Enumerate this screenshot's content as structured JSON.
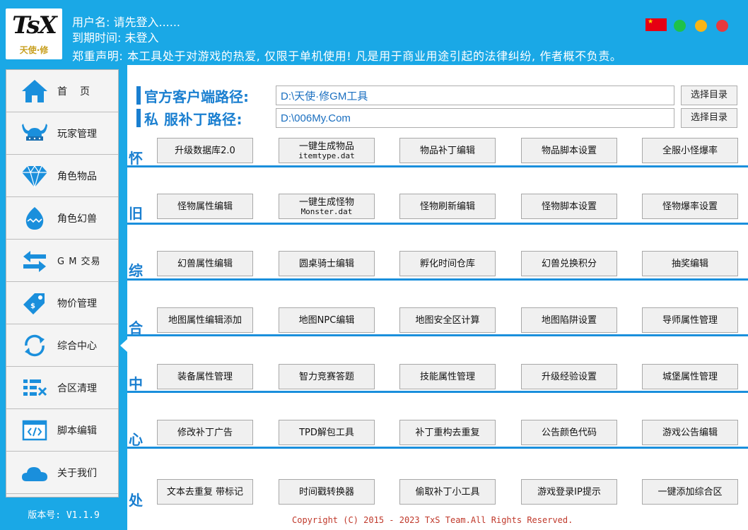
{
  "header": {
    "logo_text": "TsX",
    "logo_subtext": "天使·修",
    "username_line": "用户名: 请先登入......",
    "expiry_line": "到期时间: 未登入",
    "disclaimer_line": "郑重声明: 本工具处于对游戏的热爱, 仅限于单机使用! 凡是用于商业用途引起的法律纠纷, 作者概不负责。",
    "flag_icon": "china-flag-icon",
    "window_dots": [
      {
        "name": "green-dot",
        "color": "#1ec24a"
      },
      {
        "name": "yellow-dot",
        "color": "#f7b516"
      },
      {
        "name": "red-dot",
        "color": "#e8383d"
      }
    ]
  },
  "sidebar": {
    "items": [
      {
        "label": "首页",
        "icon": "home-icon"
      },
      {
        "label": "玩家管理",
        "icon": "viking-helmet-icon"
      },
      {
        "label": "角色物品",
        "icon": "diamond-icon"
      },
      {
        "label": "角色幻兽",
        "icon": "egg-icon"
      },
      {
        "label": "G M 交易",
        "icon": "exchange-arrows-icon"
      },
      {
        "label": "物价管理",
        "icon": "price-tag-icon"
      },
      {
        "label": "综合中心",
        "icon": "refresh-icon"
      },
      {
        "label": "合区清理",
        "icon": "list-clean-icon"
      },
      {
        "label": "脚本编辑",
        "icon": "code-window-icon"
      },
      {
        "label": "关于我们",
        "icon": "cloud-icon"
      }
    ],
    "active_item": "综合中心",
    "version": "版本号: V1.1.9"
  },
  "paths": {
    "official": {
      "label": "官方客户端路径:",
      "value": "D:\\天使·修GM工具",
      "button": "选择目录"
    },
    "private": {
      "label": "私 服补丁路径:",
      "value": "D:\\006My.Com",
      "button": "选择目录"
    }
  },
  "row_chars": [
    "怀",
    "旧",
    "综",
    "合",
    "中",
    "心",
    "处"
  ],
  "rows": [
    [
      {
        "label": "升级数据库2.0"
      },
      {
        "label": "一键生成物品",
        "sub": "itemtype.dat"
      },
      {
        "label": "物品补丁编辑"
      },
      {
        "label": "物品脚本设置"
      },
      {
        "label": "全服小怪爆率"
      }
    ],
    [
      {
        "label": "怪物属性编辑"
      },
      {
        "label": "一键生成怪物",
        "sub": "Monster.dat"
      },
      {
        "label": "怪物刷新编辑"
      },
      {
        "label": "怪物脚本设置"
      },
      {
        "label": "怪物爆率设置"
      }
    ],
    [
      {
        "label": "幻兽属性编辑"
      },
      {
        "label": "圆桌骑士编辑"
      },
      {
        "label": "孵化时间仓库"
      },
      {
        "label": "幻兽兑换积分"
      },
      {
        "label": "抽奖编辑"
      }
    ],
    [
      {
        "label": "地图属性编辑添加"
      },
      {
        "label": "地图NPC编辑"
      },
      {
        "label": "地图安全区计算"
      },
      {
        "label": "地图陷阱设置"
      },
      {
        "label": "导师属性管理"
      }
    ],
    [
      {
        "label": "装备属性管理"
      },
      {
        "label": "智力竞赛答题"
      },
      {
        "label": "技能属性管理"
      },
      {
        "label": "升级经验设置"
      },
      {
        "label": "城堡属性管理"
      }
    ],
    [
      {
        "label": "修改补丁广告"
      },
      {
        "label": "TPD解包工具"
      },
      {
        "label": "补丁重构去重复"
      },
      {
        "label": "公告颜色代码"
      },
      {
        "label": "游戏公告编辑"
      }
    ],
    [
      {
        "label": "文本去重复 带标记"
      },
      {
        "label": "时间戳转换器"
      },
      {
        "label": "偷取补丁小工具"
      },
      {
        "label": "游戏登录IP提示"
      },
      {
        "label": "一键添加综合区"
      }
    ]
  ],
  "copyright": "Copyright (C) 2015 - 2023 TxS Team.All Rights Reserved."
}
